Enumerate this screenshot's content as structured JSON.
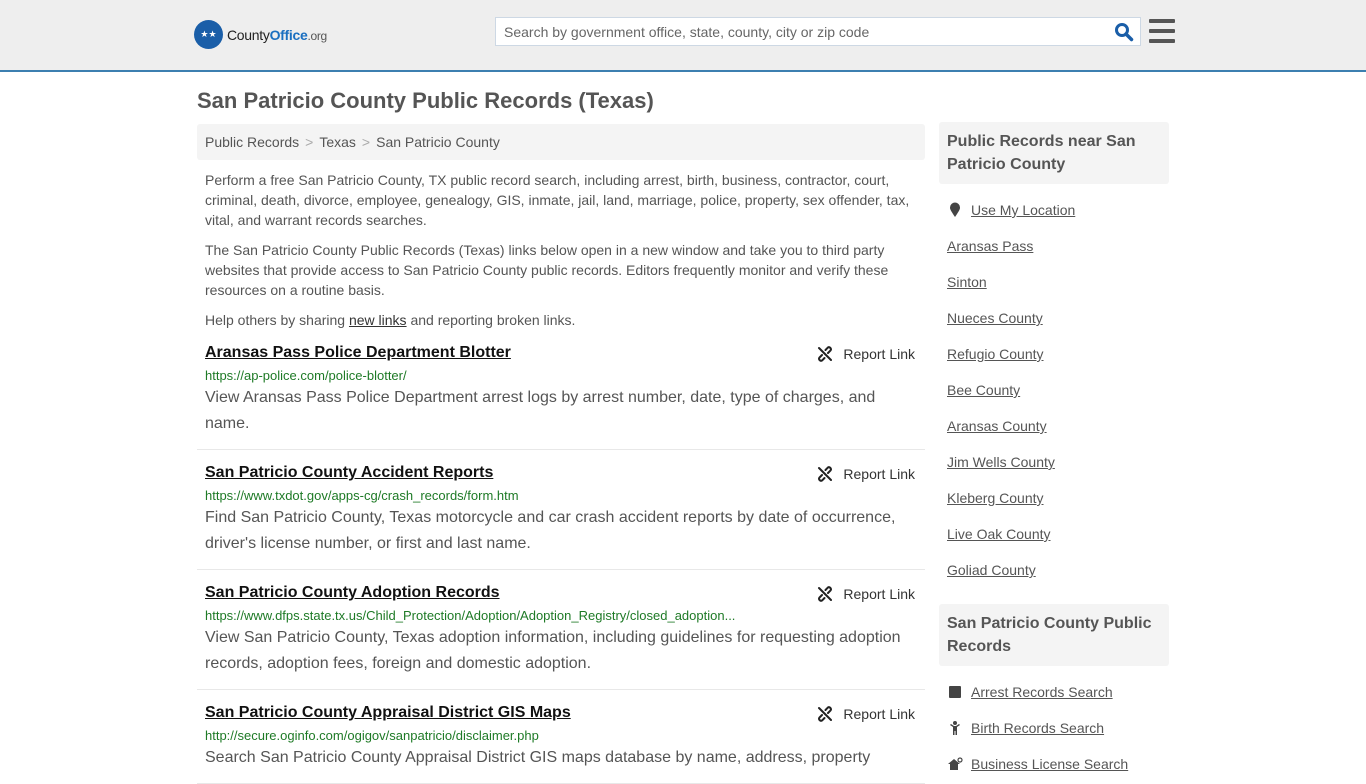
{
  "header": {
    "logo": {
      "county": "County",
      "office": "Office",
      "org": ".org"
    },
    "search_placeholder": "Search by government office, state, county, city or zip code",
    "search_icon": "search-icon",
    "menu_icon": "hamburger-menu-icon"
  },
  "page": {
    "title": "San Patricio County Public Records (Texas)"
  },
  "breadcrumb": [
    "Public Records",
    "Texas",
    "San Patricio County"
  ],
  "intro": {
    "p1": "Perform a free San Patricio County, TX public record search, including arrest, birth, business, contractor, court, criminal, death, divorce, employee, genealogy, GIS, inmate, jail, land, marriage, police, property, sex offender, tax, vital, and warrant records searches.",
    "p2": "The San Patricio County Public Records (Texas) links below open in a new window and take you to third party websites that provide access to San Patricio County public records. Editors frequently monitor and verify these resources on a routine basis.",
    "p3_before": "Help others by sharing ",
    "p3_link": "new links",
    "p3_after": " and reporting broken links."
  },
  "report_link_label": "Report Link",
  "entries": [
    {
      "title": "Aransas Pass Police Department Blotter",
      "url": "https://ap-police.com/police-blotter/",
      "desc": "View Aransas Pass Police Department arrest logs by arrest number, date, type of charges, and name."
    },
    {
      "title": "San Patricio County Accident Reports",
      "url": "https://www.txdot.gov/apps-cg/crash_records/form.htm",
      "desc": "Find San Patricio County, Texas motorcycle and car crash accident reports by date of occurrence, driver's license number, or first and last name."
    },
    {
      "title": "San Patricio County Adoption Records",
      "url": "https://www.dfps.state.tx.us/Child_Protection/Adoption/Adoption_Registry/closed_adoption...",
      "desc": "View San Patricio County, Texas adoption information, including guidelines for requesting adoption records, adoption fees, foreign and domestic adoption."
    },
    {
      "title": "San Patricio County Appraisal District GIS Maps",
      "url": "http://secure.oginfo.com/ogigov/sanpatricio/disclaimer.php",
      "desc": "Search San Patricio County Appraisal District GIS maps database by name, address, property"
    }
  ],
  "sidebar": {
    "nearby_heading": "Public Records near San Patricio County",
    "use_location": "Use My Location",
    "nearby": [
      "Aransas Pass",
      "Sinton",
      "Nueces County",
      "Refugio County",
      "Bee County",
      "Aransas County",
      "Jim Wells County",
      "Kleberg County",
      "Live Oak County",
      "Goliad County"
    ],
    "records_heading": "San Patricio County Public Records",
    "records": [
      {
        "label": "Arrest Records Search",
        "icon": "square-icon"
      },
      {
        "label": "Birth Records Search",
        "icon": "child-icon"
      },
      {
        "label": "Business License Search",
        "icon": "business-icon"
      }
    ]
  }
}
